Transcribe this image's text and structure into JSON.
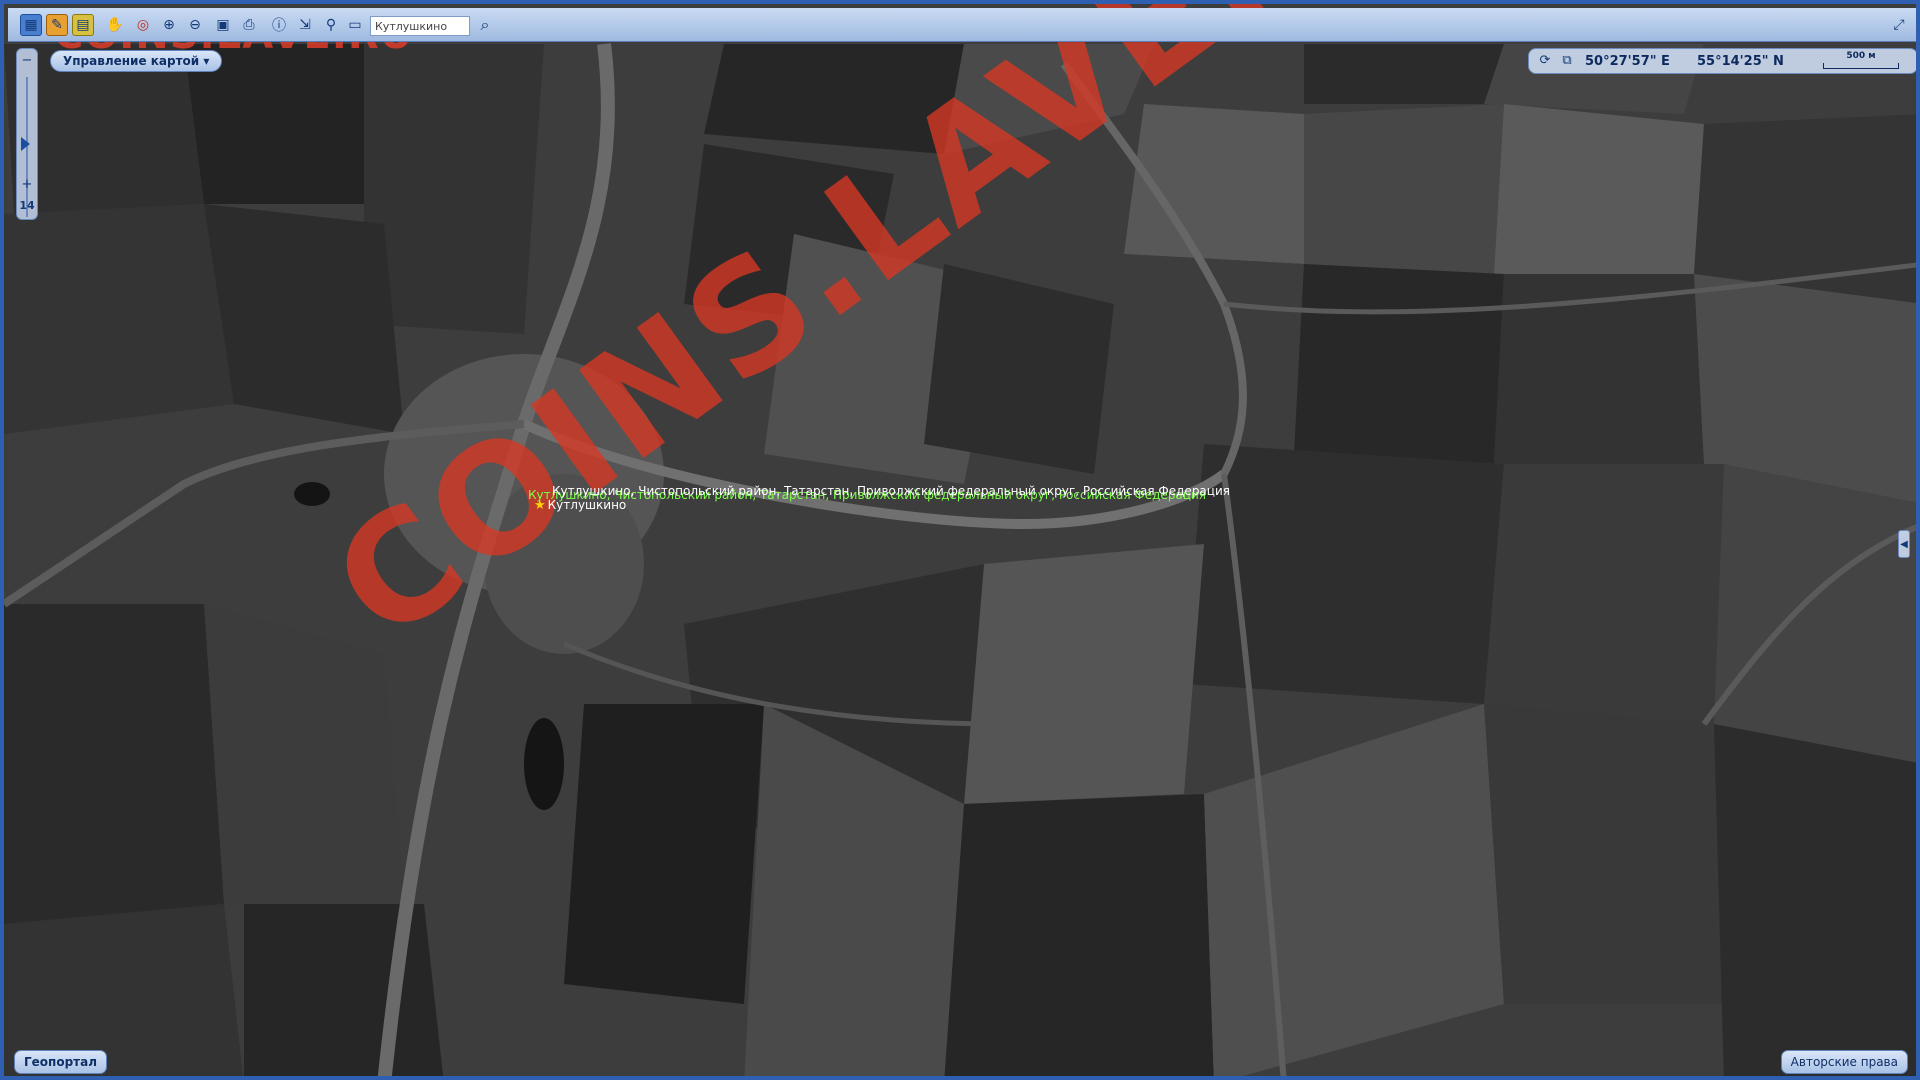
{
  "toolbar": {
    "icons": [
      "map-layer-icon",
      "edit-icon",
      "layers-icon",
      "pan-icon",
      "target-icon",
      "zoom-in-icon",
      "zoom-out-icon",
      "overview-icon",
      "print-icon",
      "info-icon",
      "measure-icon",
      "pin-icon",
      "window-icon"
    ],
    "search_value": "Кутлушкино",
    "search_icon": "magnifier-icon",
    "expand_icon": "fullscreen-icon"
  },
  "zoom": {
    "minus": "−",
    "plus": "+",
    "level": "14"
  },
  "manage_map": {
    "label": "Управление картой ▾"
  },
  "coords": {
    "lon": "50°27'57\" E",
    "lat": "55°14'25\" N",
    "scale_label": "500 м"
  },
  "places": {
    "line_green": "Кутлушкино, Чистопольский район, Татарстан, Приволжский федеральный округ, Российская Федерация",
    "line_white": "Кутлушкино, Чистопольский район, Татарстан, Приволжский федеральный округ, Российская Федерация",
    "marker_label": "Кутлушкино",
    "marker_icon": "★"
  },
  "bottom": {
    "geoportal": "Геопортал",
    "copyright": "Авторские права"
  },
  "watermark": {
    "small": "COINS.LAVE.RU",
    "big": "COINS.LAVE.RU"
  },
  "colors": {
    "frame": "#2f5fb0",
    "watermark": "#d73723",
    "label_green": "#7dff4a"
  }
}
